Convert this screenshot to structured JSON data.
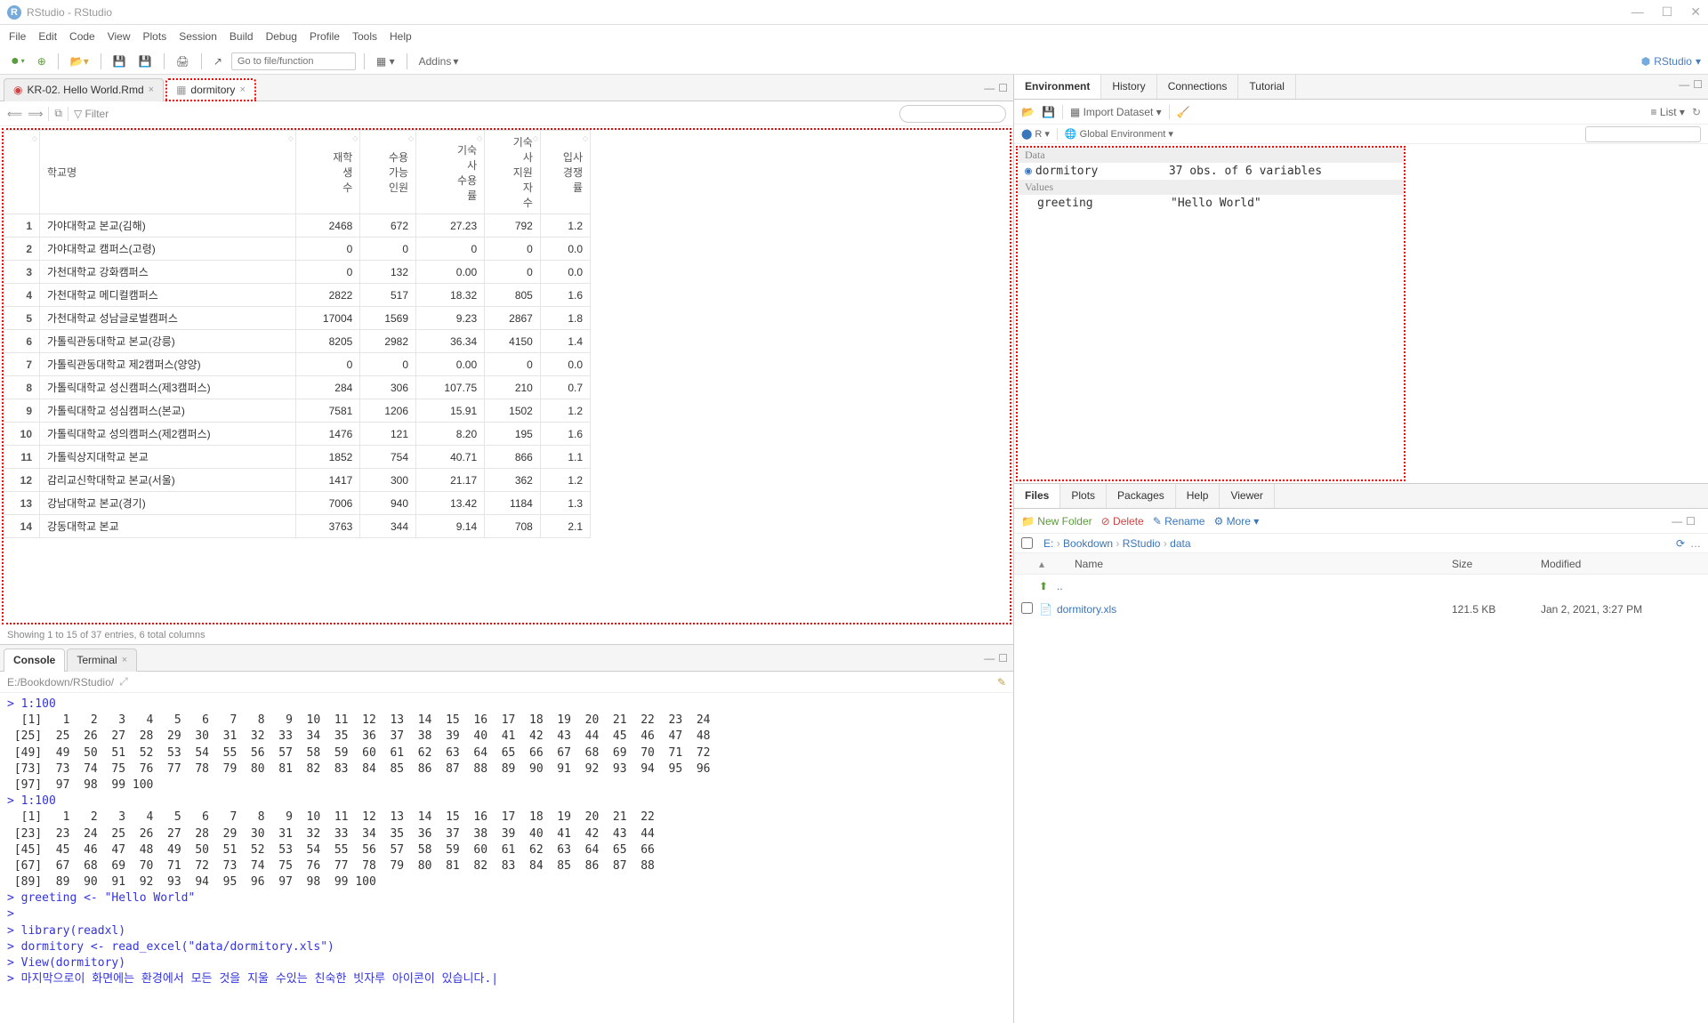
{
  "title": "RStudio - RStudio",
  "menu": [
    "File",
    "Edit",
    "Code",
    "View",
    "Plots",
    "Session",
    "Build",
    "Debug",
    "Profile",
    "Tools",
    "Help"
  ],
  "toolbar": {
    "goto": "Go to file/function",
    "addins": "Addins",
    "project": "RStudio"
  },
  "tabs": {
    "t1": "KR-02. Hello World.Rmd",
    "t2": "dormitory"
  },
  "viewer": {
    "filter": "Filter"
  },
  "columns": [
    "",
    "학교명",
    "재학생수",
    "수용가능인원",
    "기숙사수용률",
    "기숙사지원자수",
    "입사경쟁률"
  ],
  "rows": [
    [
      "1",
      "가야대학교 본교(김해)",
      "2468",
      "672",
      "27.23",
      "792",
      "1.2"
    ],
    [
      "2",
      "가야대학교 캠퍼스(고령)",
      "0",
      "0",
      "0",
      "0",
      "0.0"
    ],
    [
      "3",
      "가천대학교 강화캠퍼스",
      "0",
      "132",
      "0.00",
      "0",
      "0.0"
    ],
    [
      "4",
      "가천대학교 메디컬캠퍼스",
      "2822",
      "517",
      "18.32",
      "805",
      "1.6"
    ],
    [
      "5",
      "가천대학교 성남글로벌캠퍼스",
      "17004",
      "1569",
      "9.23",
      "2867",
      "1.8"
    ],
    [
      "6",
      "가톨릭관동대학교 본교(강릉)",
      "8205",
      "2982",
      "36.34",
      "4150",
      "1.4"
    ],
    [
      "7",
      "가톨릭관동대학교 제2캠퍼스(양양)",
      "0",
      "0",
      "0.00",
      "0",
      "0.0"
    ],
    [
      "8",
      "가톨릭대학교 성신캠퍼스(제3캠퍼스)",
      "284",
      "306",
      "107.75",
      "210",
      "0.7"
    ],
    [
      "9",
      "가톨릭대학교 성심캠퍼스(본교)",
      "7581",
      "1206",
      "15.91",
      "1502",
      "1.2"
    ],
    [
      "10",
      "가톨릭대학교 성의캠퍼스(제2캠퍼스)",
      "1476",
      "121",
      "8.20",
      "195",
      "1.6"
    ],
    [
      "11",
      "가톨릭상지대학교 본교",
      "1852",
      "754",
      "40.71",
      "866",
      "1.1"
    ],
    [
      "12",
      "감리교신학대학교 본교(서울)",
      "1417",
      "300",
      "21.17",
      "362",
      "1.2"
    ],
    [
      "13",
      "강남대학교 본교(경기)",
      "7006",
      "940",
      "13.42",
      "1184",
      "1.3"
    ],
    [
      "14",
      "강동대학교 본교",
      "3763",
      "344",
      "9.14",
      "708",
      "2.1"
    ]
  ],
  "table_status": "Showing 1 to 15 of 37 entries, 6 total columns",
  "console_tabs": {
    "console": "Console",
    "terminal": "Terminal"
  },
  "console_path": "E:/Bookdown/RStudio/",
  "console_lines": [
    {
      "t": "p",
      "s": "> "
    },
    {
      "t": "c",
      "s": "1:100"
    },
    {
      "t": "o",
      "s": "  [1]   1   2   3   4   5   6   7   8   9  10  11  12  13  14  15  16  17  18  19  20  21  22  23  24"
    },
    {
      "t": "o",
      "s": " [25]  25  26  27  28  29  30  31  32  33  34  35  36  37  38  39  40  41  42  43  44  45  46  47  48"
    },
    {
      "t": "o",
      "s": " [49]  49  50  51  52  53  54  55  56  57  58  59  60  61  62  63  64  65  66  67  68  69  70  71  72"
    },
    {
      "t": "o",
      "s": " [73]  73  74  75  76  77  78  79  80  81  82  83  84  85  86  87  88  89  90  91  92  93  94  95  96"
    },
    {
      "t": "o",
      "s": " [97]  97  98  99 100"
    },
    {
      "t": "p",
      "s": "> "
    },
    {
      "t": "c",
      "s": "1:100"
    },
    {
      "t": "o",
      "s": "  [1]   1   2   3   4   5   6   7   8   9  10  11  12  13  14  15  16  17  18  19  20  21  22"
    },
    {
      "t": "o",
      "s": " [23]  23  24  25  26  27  28  29  30  31  32  33  34  35  36  37  38  39  40  41  42  43  44"
    },
    {
      "t": "o",
      "s": " [45]  45  46  47  48  49  50  51  52  53  54  55  56  57  58  59  60  61  62  63  64  65  66"
    },
    {
      "t": "o",
      "s": " [67]  67  68  69  70  71  72  73  74  75  76  77  78  79  80  81  82  83  84  85  86  87  88"
    },
    {
      "t": "o",
      "s": " [89]  89  90  91  92  93  94  95  96  97  98  99 100"
    },
    {
      "t": "p",
      "s": "> "
    },
    {
      "t": "c",
      "s": "greeting <- \"Hello World\""
    },
    {
      "t": "p",
      "s": "> "
    },
    {
      "t": "c",
      "s": ""
    },
    {
      "t": "p",
      "s": "> "
    },
    {
      "t": "c",
      "s": "library(readxl)"
    },
    {
      "t": "p",
      "s": "> "
    },
    {
      "t": "c",
      "s": "dormitory <- read_excel(\"data/dormitory.xls\")"
    },
    {
      "t": "p",
      "s": "> "
    },
    {
      "t": "c",
      "s": "View(dormitory)"
    },
    {
      "t": "p",
      "s": "> "
    },
    {
      "t": "c",
      "s": "마지막으로이 화면에는 환경에서 모든 것을 지울 수있는 친숙한 빗자루 아이콘이 있습니다.|"
    }
  ],
  "env_tabs": [
    "Environment",
    "History",
    "Connections",
    "Tutorial"
  ],
  "env_toolbar": {
    "import": "Import Dataset",
    "list": "List"
  },
  "env_scope": {
    "lang": "R",
    "scope": "Global Environment"
  },
  "env": {
    "data_heading": "Data",
    "dormitory_name": "dormitory",
    "dormitory_val": "37 obs. of 6 variables",
    "values_heading": "Values",
    "greeting_name": "greeting",
    "greeting_val": "\"Hello World\""
  },
  "files_tabs": [
    "Files",
    "Plots",
    "Packages",
    "Help",
    "Viewer"
  ],
  "files_toolbar": {
    "newfolder": "New Folder",
    "delete": "Delete",
    "rename": "Rename",
    "more": "More"
  },
  "breadcrumb": [
    "E:",
    "Bookdown",
    "RStudio",
    "data"
  ],
  "file_header": {
    "name": "Name",
    "size": "Size",
    "mod": "Modified"
  },
  "files": [
    {
      "name": "..",
      "size": "",
      "mod": "",
      "up": true
    },
    {
      "name": "dormitory.xls",
      "size": "121.5 KB",
      "mod": "Jan 2, 2021, 3:27 PM",
      "up": false
    }
  ]
}
